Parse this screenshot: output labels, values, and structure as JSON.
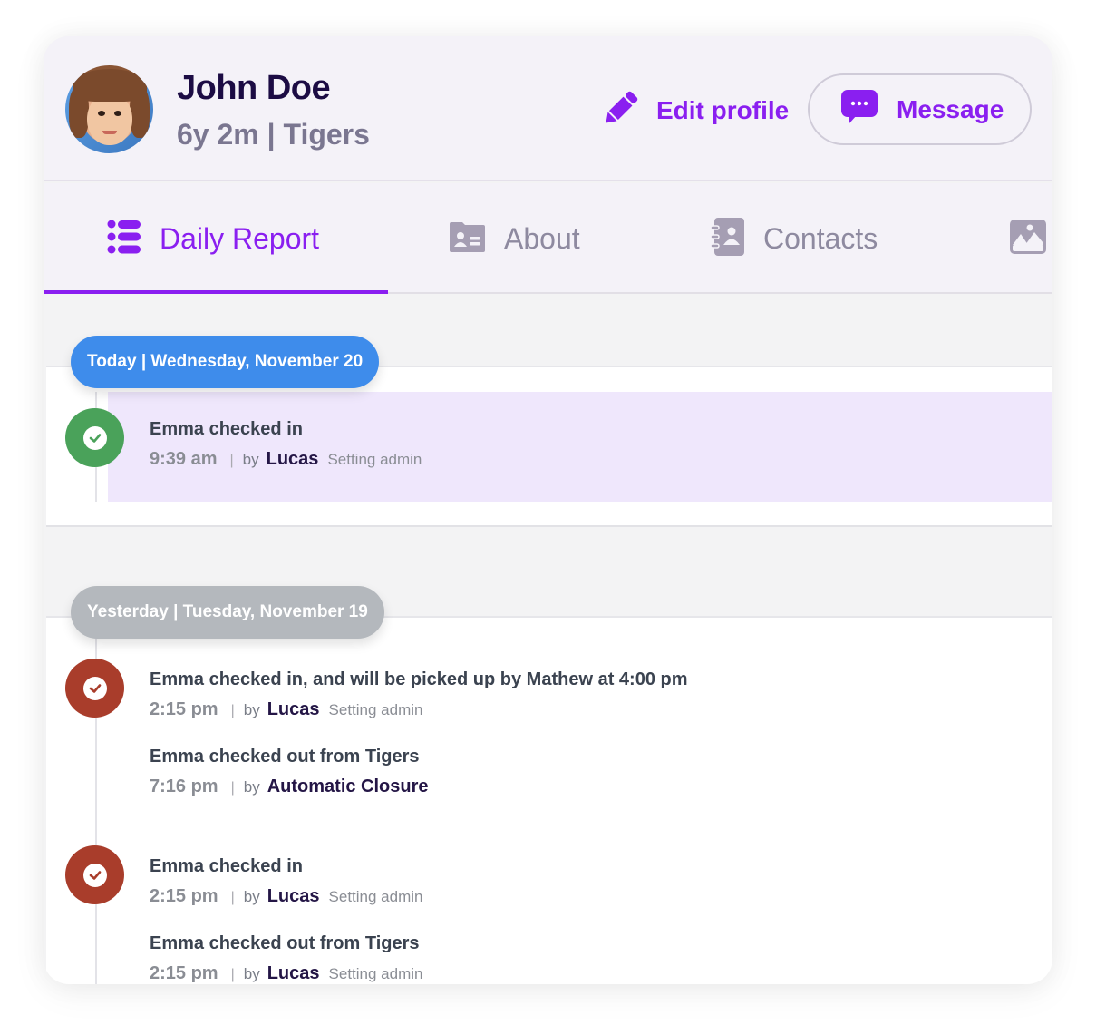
{
  "profile": {
    "name": "John Doe",
    "age": "6y 2m",
    "separator": "|",
    "group": "Tigers",
    "avatar_icon": "child-photo-avatar"
  },
  "actions": {
    "edit_label": "Edit profile",
    "edit_icon": "pencil-icon",
    "message_label": "Message",
    "message_icon": "chat-bubble-icon"
  },
  "tabs": [
    {
      "label": "Daily Report",
      "icon": "list-icon",
      "active": true
    },
    {
      "label": "About",
      "icon": "id-card-icon",
      "active": false
    },
    {
      "label": "Contacts",
      "icon": "address-book-icon",
      "active": false
    },
    {
      "label": "",
      "icon": "image-icon",
      "active": false
    }
  ],
  "colors": {
    "accent": "#8a1ff0",
    "today_pill": "#3e8ceb",
    "yesterday_pill": "#b4b8bd",
    "checkin_today": "#4aa25a",
    "checkin_past": "#a93d2b",
    "highlight": "#efe7fc"
  },
  "days": [
    {
      "label": "Today | Wednesday, November 20",
      "events": [
        {
          "title": "Emma checked in",
          "time": "9:39 am",
          "sep": "|",
          "by": "by",
          "who": "Lucas",
          "role": "Setting admin"
        }
      ]
    },
    {
      "label": "Yesterday | Tuesday, November 19",
      "events": [
        {
          "title": "Emma checked in, and will be picked up by Mathew at 4:00 pm",
          "time": "2:15 pm",
          "sep": "|",
          "by": "by",
          "who": "Lucas",
          "role": "Setting admin"
        },
        {
          "title": "Emma checked out from Tigers",
          "time": "7:16 pm",
          "sep": "|",
          "by": "by",
          "who": "Automatic Closure",
          "role": ""
        },
        {
          "title": "Emma checked in",
          "time": "2:15 pm",
          "sep": "|",
          "by": "by",
          "who": "Lucas",
          "role": "Setting admin"
        },
        {
          "title": "Emma checked out from Tigers",
          "time": "2:15 pm",
          "sep": "|",
          "by": "by",
          "who": "Lucas",
          "role": "Setting admin"
        }
      ]
    }
  ]
}
